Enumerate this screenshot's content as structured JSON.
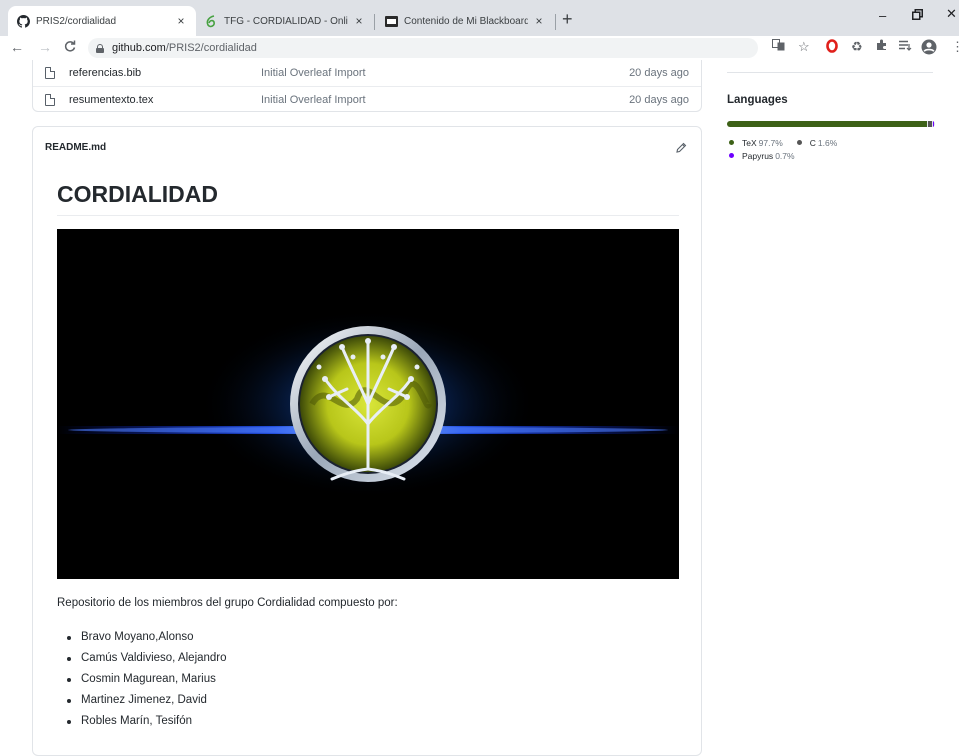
{
  "browser": {
    "tabs": [
      {
        "title": "PRIS2/cordialidad",
        "icon": "github-icon",
        "active": true
      },
      {
        "title": "TFG - CORDIALIDAD - Online La",
        "icon": "overleaf-icon",
        "active": false
      },
      {
        "title": "Contenido de Mi Blackboard – B",
        "icon": "blackboard-icon",
        "active": false
      }
    ],
    "close_glyph": "×",
    "new_tab_glyph": "+",
    "url_host": "github.com",
    "url_path": "/PRIS2/cordialidad"
  },
  "files": [
    {
      "name": "referencias.bib",
      "message": "Initial Overleaf Import",
      "age": "20 days ago"
    },
    {
      "name": "resumentexto.tex",
      "message": "Initial Overleaf Import",
      "age": "20 days ago"
    }
  ],
  "readme": {
    "filename": "README.md",
    "title": "CORDIALIDAD",
    "description": "Repositorio de los miembros del grupo Cordialidad compuesto por:",
    "members": [
      "Bravo Moyano,Alonso",
      "Camús Valdivieso, Alejandro",
      "Cosmin Magurean, Marius",
      "Martinez Jimenez, David",
      "Robles Marín, Tesifón"
    ]
  },
  "languages": {
    "title": "Languages",
    "items": [
      {
        "name": "TeX",
        "percent": "97.7%",
        "value": 97.7,
        "color": "#3D6117"
      },
      {
        "name": "C",
        "percent": "1.6%",
        "value": 1.6,
        "color": "#555555"
      },
      {
        "name": "Papyrus",
        "percent": "0.7%",
        "value": 0.7,
        "color": "#6E00FF"
      }
    ]
  }
}
